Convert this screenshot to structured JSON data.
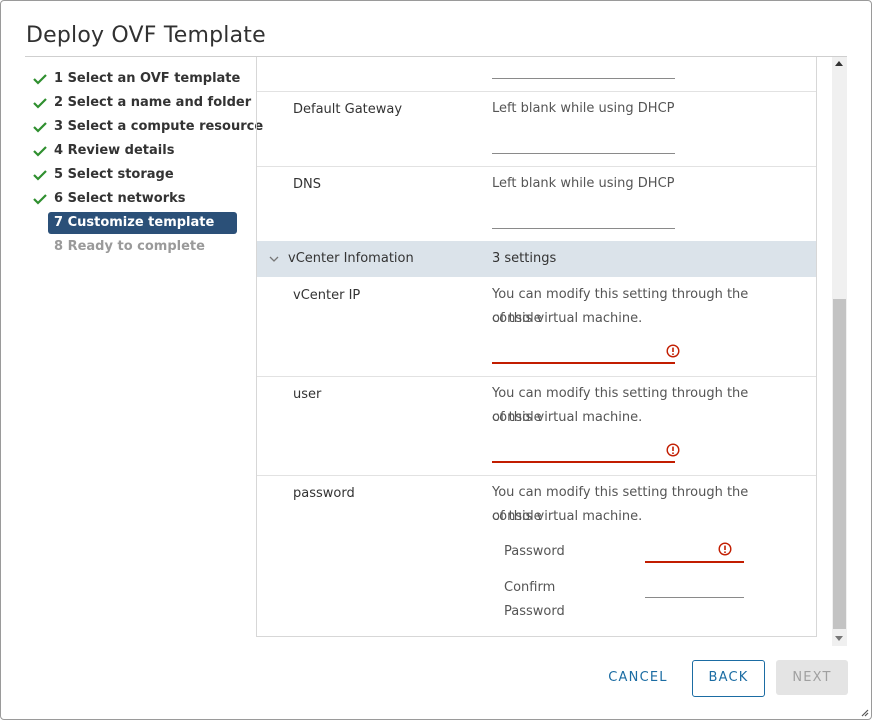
{
  "dialog": {
    "title": "Deploy OVF Template"
  },
  "steps": [
    {
      "label": "1 Select an OVF template",
      "state": "done"
    },
    {
      "label": "2 Select a name and folder",
      "state": "done"
    },
    {
      "label": "3 Select a compute resource",
      "state": "done"
    },
    {
      "label": "4 Review details",
      "state": "done"
    },
    {
      "label": "5 Select storage",
      "state": "done"
    },
    {
      "label": "6 Select networks",
      "state": "done"
    },
    {
      "label": "7 Customize template",
      "state": "active"
    },
    {
      "label": "8 Ready to complete",
      "state": "disabled"
    }
  ],
  "settings": {
    "default_gateway": {
      "name": "Default Gateway",
      "desc": "Left blank while using DHCP",
      "value": ""
    },
    "dns": {
      "name": "DNS",
      "desc": "Left blank while using DHCP",
      "value": ""
    },
    "group": {
      "name": "vCenter Infomation",
      "count": "3 settings"
    },
    "vcenter_ip": {
      "name": "vCenter IP",
      "desc_line1": "You can modify this setting through the console",
      "desc_line2": "of this virtual machine.",
      "value": ""
    },
    "user": {
      "name": "user",
      "desc_line1": "You can modify this setting through the console",
      "desc_line2": "of this virtual machine.",
      "value": ""
    },
    "password": {
      "name": "password",
      "desc_line1": "You can modify this setting through the console",
      "desc_line2": "of this virtual machine.",
      "password_label": "Password",
      "confirm_label_1": "Confirm",
      "confirm_label_2": "Password"
    }
  },
  "buttons": {
    "cancel": "CANCEL",
    "back": "BACK",
    "next": "NEXT"
  },
  "colors": {
    "accent": "#1b6ca3",
    "active_step": "#2b5078",
    "check": "#2f8f2f",
    "error": "#c21d00",
    "group_header": "#dbe3ea"
  },
  "icons": {
    "done": "checkmark-icon",
    "error": "error-circle-icon",
    "chevron": "chevron-down-icon"
  }
}
